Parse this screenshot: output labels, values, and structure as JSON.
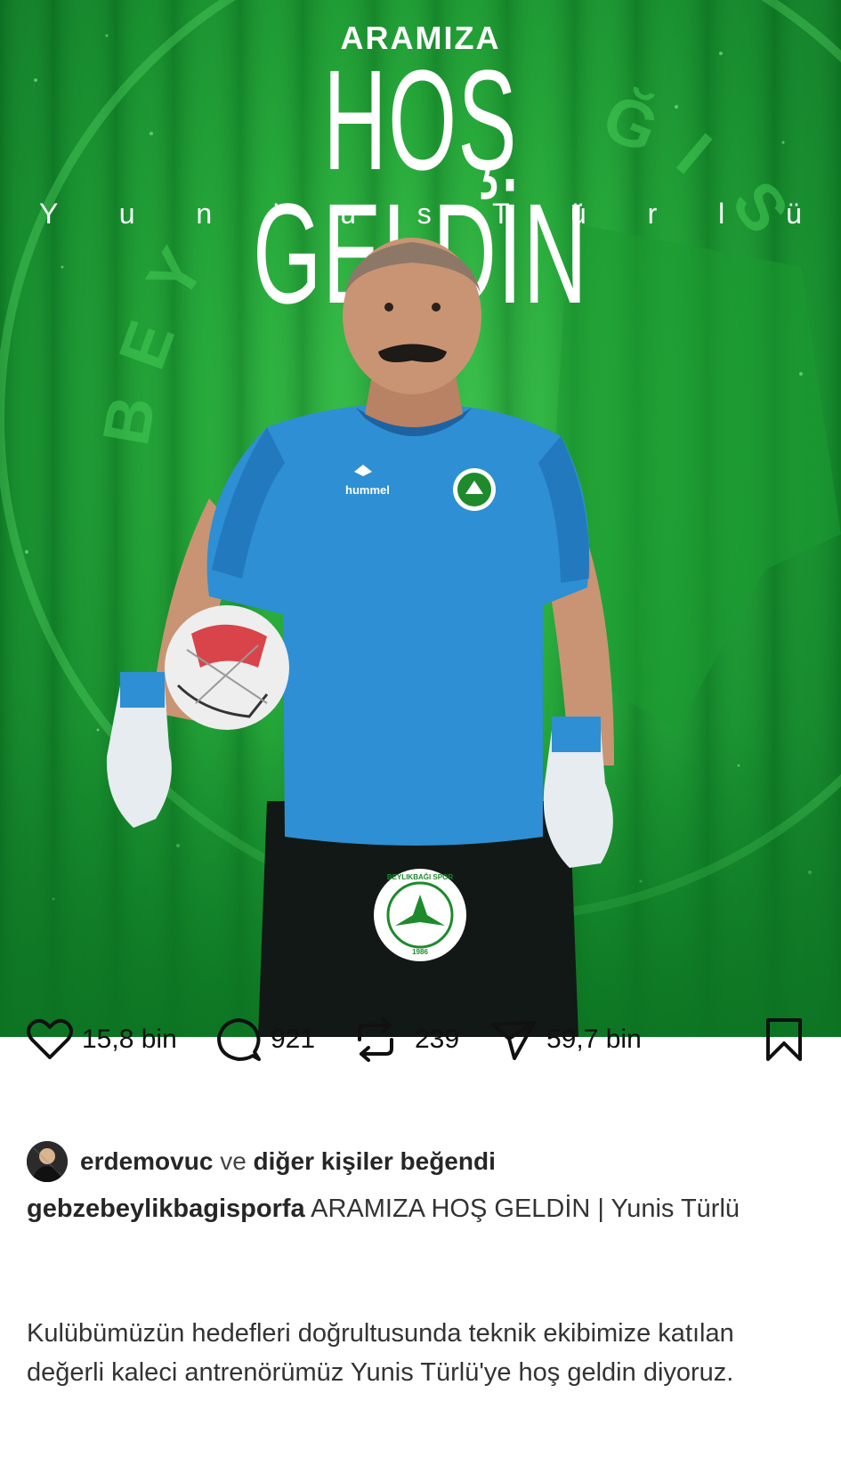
{
  "poster": {
    "title_top": "ARAMIZA",
    "title_main": "HOŞ GELDİN",
    "player_name": "Y u n ' u s   T ü r l ü",
    "background_letters": [
      "B",
      "E",
      "Y",
      "Ğ",
      "I",
      "S"
    ],
    "badge_text_top": "BEYLIKBAĞI SPOR",
    "badge_year": "1986",
    "shirt_brand": "hummel",
    "colors": {
      "green_light": "#3fc44e",
      "green_dark": "#0b6a20",
      "shirt_blue": "#2e8fd4",
      "badge_green": "#1e8a2c"
    }
  },
  "actions": {
    "like_count": "15,8 bin",
    "comment_count": "921",
    "repost_count": "239",
    "share_count": "59,7 bin",
    "icons": [
      "heart-icon",
      "comment-icon",
      "repost-icon",
      "send-icon",
      "bookmark-icon"
    ]
  },
  "likes": {
    "user": "erdemovuc",
    "connector": "ve",
    "rest": "diğer kişiler beğendi"
  },
  "caption": {
    "username": "gebzebeylikbagisporfa",
    "headline": "ARAMIZA HOŞ GELDİN | Yunis Türlü",
    "body": "Kulübümüzün hedefleri doğrultusunda teknik ekibimize katılan değerli kaleci antrenörümüz Yunis Türlü'ye hoş geldin diyoruz."
  }
}
